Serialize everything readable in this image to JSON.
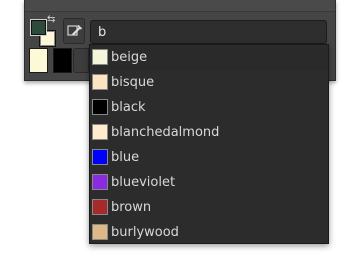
{
  "search": {
    "value": "b"
  },
  "colors": {
    "foreground": "#2e4a3a",
    "background": "#fdf6d8",
    "history": [
      "#fdf8d6",
      "#000000"
    ]
  },
  "suggestions": [
    {
      "name": "beige",
      "color": "#f5f5dc"
    },
    {
      "name": "bisque",
      "color": "#ffe4c4"
    },
    {
      "name": "black",
      "color": "#000000"
    },
    {
      "name": "blanchedalmond",
      "color": "#ffebcd"
    },
    {
      "name": "blue",
      "color": "#0000ff"
    },
    {
      "name": "blueviolet",
      "color": "#8a2be2"
    },
    {
      "name": "brown",
      "color": "#a52a2a"
    },
    {
      "name": "burlywood",
      "color": "#deb887"
    }
  ],
  "icons": {
    "swap": "swap-colors-icon",
    "reset": "default-colors-icon",
    "picker": "color-picker-icon"
  }
}
